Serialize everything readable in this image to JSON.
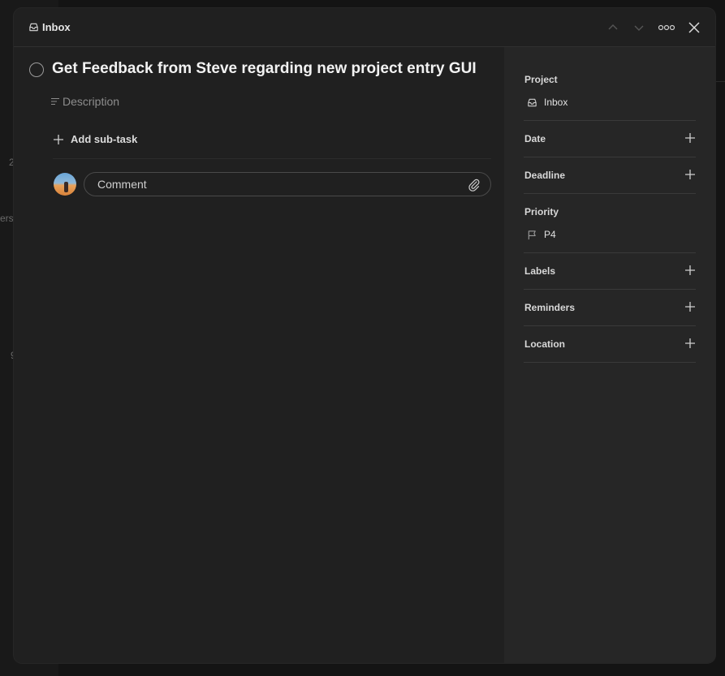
{
  "header": {
    "breadcrumb": "Inbox",
    "icons": [
      "inbox-icon",
      "chevron-up-icon",
      "chevron-down-icon",
      "more-icon",
      "close-icon"
    ]
  },
  "background": {
    "fragments": [
      "2",
      "ers",
      "9"
    ]
  },
  "task": {
    "title": "Get Feedback from Steve regarding new project entry GUI",
    "description_placeholder": "Description",
    "add_subtask_label": "Add sub-task",
    "comment_placeholder": "Comment"
  },
  "sidebar": {
    "project": {
      "label": "Project",
      "value": "Inbox"
    },
    "date": {
      "label": "Date"
    },
    "deadline": {
      "label": "Deadline"
    },
    "priority": {
      "label": "Priority",
      "value": "P4"
    },
    "labels": {
      "label": "Labels"
    },
    "reminders": {
      "label": "Reminders"
    },
    "location": {
      "label": "Location"
    }
  },
  "colors": {
    "modal_bg": "#202020",
    "sidebar_bg": "#262626",
    "text": "#e8e8e8",
    "muted": "#8d8d8d"
  }
}
